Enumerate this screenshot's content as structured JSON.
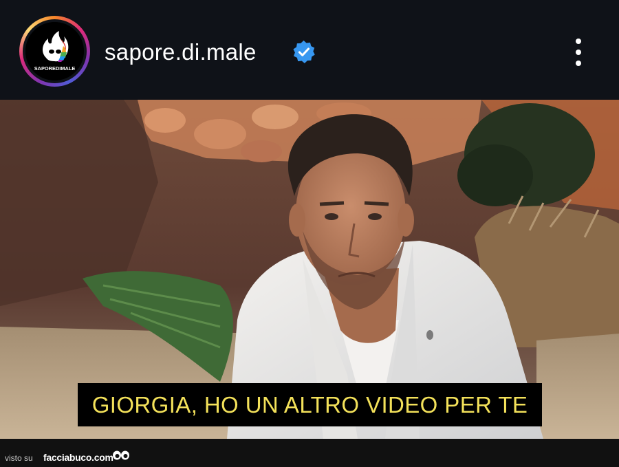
{
  "post": {
    "username": "sapore.di.male",
    "avatar_text": "SAPOREDIMALE",
    "verified_icon": "verified-badge-icon",
    "more_icon": "more-vertical-icon"
  },
  "video": {
    "subtitle": "GIORGIA, HO UN ALTRO VIDEO PER TE"
  },
  "footer": {
    "visto_label": "visto su",
    "site_label": "facciabuco.com",
    "eyes_icon": "eyes-icon"
  },
  "colors": {
    "verified_blue": "#3797f0",
    "subtitle_yellow": "#f3e15a",
    "header_bg": "#0f1218"
  }
}
